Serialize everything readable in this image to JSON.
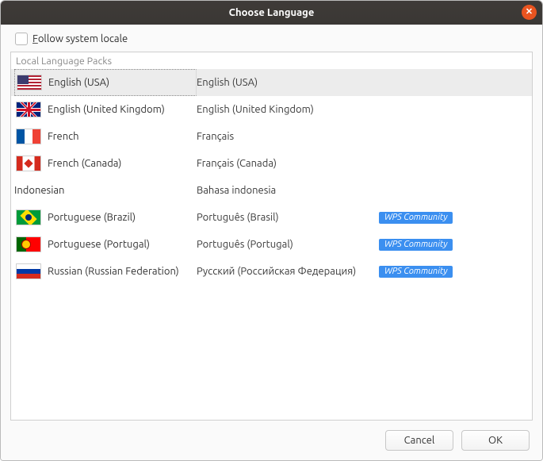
{
  "window": {
    "title": "Choose Language"
  },
  "follow": {
    "label_pre": "F",
    "label_rest": "ollow system locale",
    "checked": false
  },
  "panel": {
    "header": "Local Language Packs"
  },
  "languages": [
    {
      "flag": "us",
      "name": "English (USA)",
      "native": "English (USA)",
      "badge": null,
      "selected": true
    },
    {
      "flag": "uk",
      "name": "English (United Kingdom)",
      "native": "English (United Kingdom)",
      "badge": null,
      "selected": false
    },
    {
      "flag": "fr",
      "name": "French",
      "native": "Français",
      "badge": null,
      "selected": false
    },
    {
      "flag": "ca",
      "name": "French (Canada)",
      "native": "Français (Canada)",
      "badge": null,
      "selected": false
    },
    {
      "flag": null,
      "name": "Indonesian",
      "native": "Bahasa indonesia",
      "badge": null,
      "selected": false
    },
    {
      "flag": "br",
      "name": "Portuguese (Brazil)",
      "native": "Português (Brasil)",
      "badge": "WPS Community",
      "selected": false
    },
    {
      "flag": "pt",
      "name": "Portuguese (Portugal)",
      "native": "Português (Portugal)",
      "badge": "WPS Community",
      "selected": false
    },
    {
      "flag": "ru",
      "name": "Russian (Russian Federation)",
      "native": "Русский (Российская Федерация)",
      "badge": "WPS Community",
      "selected": false
    }
  ],
  "buttons": {
    "cancel": "Cancel",
    "ok": "OK"
  }
}
